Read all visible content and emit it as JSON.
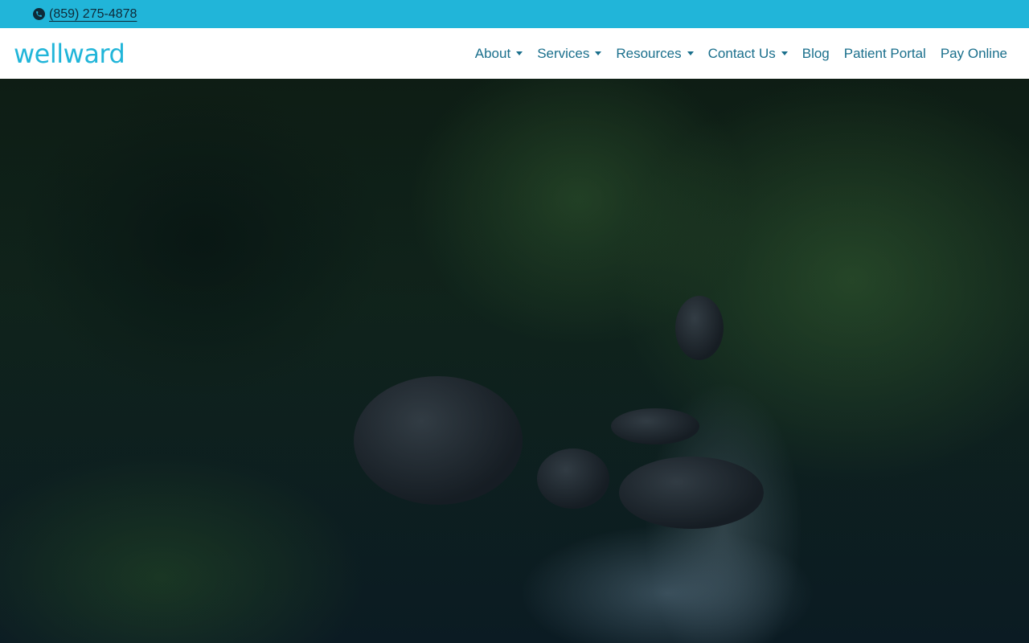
{
  "topbar": {
    "phone": "(859) 275-4878",
    "phone_icon": "phone-icon"
  },
  "header": {
    "logo_text": "wellward"
  },
  "nav": {
    "items": [
      {
        "label": "About",
        "dropdown": true
      },
      {
        "label": "Services",
        "dropdown": true
      },
      {
        "label": "Resources",
        "dropdown": true
      },
      {
        "label": "Contact Us",
        "dropdown": true
      },
      {
        "label": "Blog",
        "dropdown": false
      },
      {
        "label": "Patient Portal",
        "dropdown": false
      },
      {
        "label": "Pay Online",
        "dropdown": false
      }
    ]
  },
  "colors": {
    "accent": "#21b5d9",
    "nav_text": "#1a6f8c",
    "topbar_text": "#0e2a38"
  }
}
